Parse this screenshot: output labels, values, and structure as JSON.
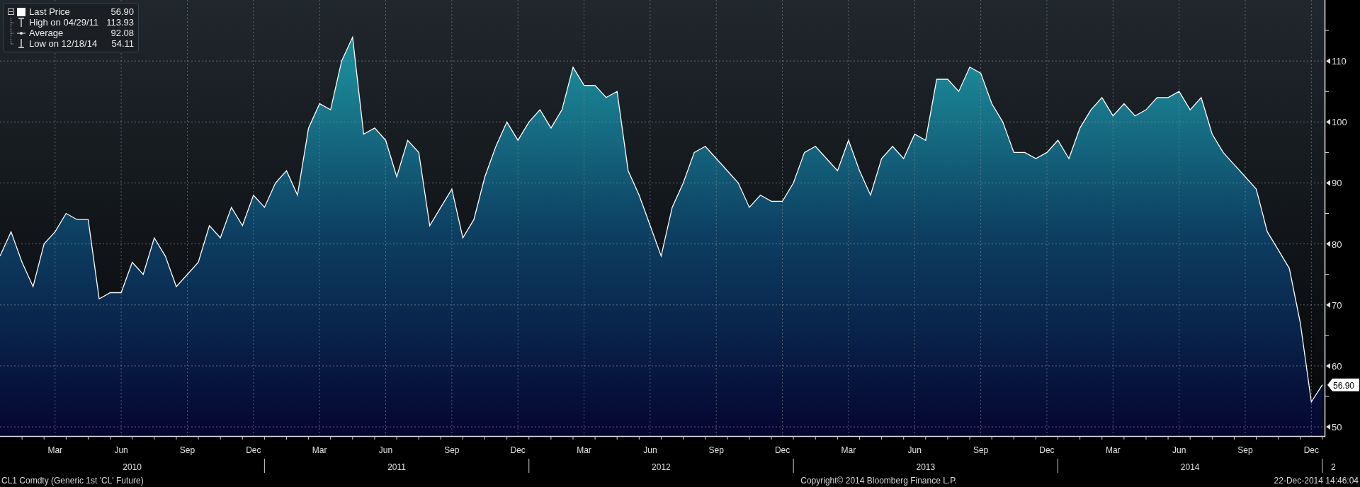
{
  "legend": {
    "items": [
      {
        "kind": "last",
        "value": "56.90"
      },
      {
        "kind": "high",
        "label": "High on 04/29/11",
        "value": "113.93"
      },
      {
        "kind": "average",
        "label": "Average",
        "value": "92.08"
      },
      {
        "kind": "low",
        "label": "Low on 12/18/14",
        "value": "54.11"
      }
    ]
  },
  "chart": {
    "chart_data": {
      "type": "area",
      "categories": [
        null,
        null,
        null,
        null,
        null,
        "Mar",
        null,
        null,
        null,
        null,
        null,
        "Jun",
        null,
        null,
        null,
        null,
        null,
        "Sep",
        null,
        null,
        null,
        null,
        null,
        "Dec",
        null,
        null,
        null,
        null,
        null,
        "Mar",
        null,
        null,
        null,
        null,
        null,
        "Jun",
        null,
        null,
        null,
        null,
        null,
        "Sep",
        null,
        null,
        null,
        null,
        null,
        "Dec",
        null,
        null,
        null,
        null,
        null,
        "Mar",
        null,
        null,
        null,
        null,
        null,
        "Jun",
        null,
        null,
        null,
        null,
        null,
        "Sep",
        null,
        null,
        null,
        null,
        null,
        "Dec",
        null,
        null,
        null,
        null,
        null,
        "Mar",
        null,
        null,
        null,
        null,
        null,
        "Jun",
        null,
        null,
        null,
        null,
        null,
        "Sep",
        null,
        null,
        null,
        null,
        null,
        "Dec",
        null,
        null,
        null,
        null,
        null,
        "Mar",
        null,
        null,
        null,
        null,
        null,
        "Jun",
        null,
        null,
        null,
        null,
        null,
        "Sep",
        null,
        null,
        null,
        null,
        null,
        "Dec",
        null
      ],
      "series": [
        {
          "name": "Last Price",
          "color": "#ffffff",
          "values": [
            78,
            82,
            77,
            73,
            80,
            82,
            85,
            84,
            84,
            71,
            72,
            72,
            77,
            75,
            81,
            78,
            73,
            75,
            77,
            83,
            81,
            86,
            83,
            88,
            86,
            90,
            92,
            88,
            99,
            103,
            102,
            110,
            113.9,
            98,
            99,
            97,
            91,
            97,
            95,
            83,
            86,
            89,
            81,
            84,
            91,
            96,
            100,
            97,
            100,
            102,
            99,
            102,
            109,
            106,
            106,
            104,
            105,
            92,
            88,
            83,
            78,
            86,
            90,
            95,
            96,
            94,
            92,
            90,
            86,
            88,
            87,
            87,
            90,
            95,
            96,
            94,
            92,
            97,
            92,
            88,
            94,
            96,
            94,
            98,
            97,
            107,
            107,
            105,
            109,
            108,
            103,
            100,
            95,
            95,
            94,
            95,
            97,
            94,
            99,
            102,
            104,
            101,
            103,
            101,
            102,
            104,
            104,
            105,
            102,
            104,
            98,
            95,
            93,
            91,
            89,
            82,
            79,
            76,
            67,
            54.1,
            56.9
          ]
        }
      ],
      "ylim": [
        48.5,
        120
      ],
      "grid": true,
      "yticks": [
        50,
        60,
        70,
        80,
        90,
        100,
        110
      ]
    },
    "year_labels": [
      "2010",
      "2011",
      "2012",
      "2013",
      "2014",
      "2"
    ],
    "last_price_marker": "56.90"
  },
  "footer": {
    "security": "CL1 Comdty (Generic 1st 'CL' Future)",
    "copyright": "Copyright© 2014 Bloomberg Finance L.P.",
    "timestamp": "22-Dec-2014 14:46:04"
  }
}
